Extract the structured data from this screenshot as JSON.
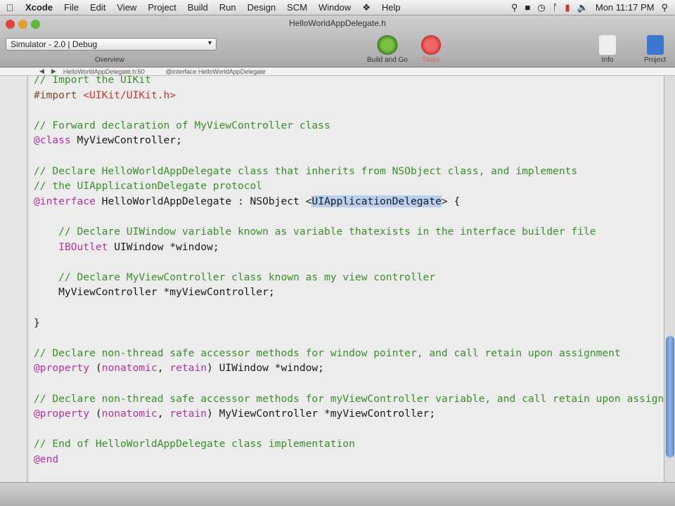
{
  "menubar": {
    "app": "Xcode",
    "items": [
      "File",
      "Edit",
      "View",
      "Project",
      "Build",
      "Run",
      "Design",
      "SCM",
      "Window",
      "Help"
    ],
    "clock": "Mon 11:17 PM"
  },
  "window": {
    "title": "HelloWorldAppDelegate.h"
  },
  "toolbar": {
    "scheme": "Simulator - 2.0 | Debug",
    "overview_label": "Overview",
    "build_go": "Build and Go",
    "tasks": "Tasks",
    "info": "Info",
    "project": "Project"
  },
  "navbar": {
    "file": "HelloWorldAppDelegate.h:60",
    "symbol": "@interface HelloWorldAppDelegate"
  },
  "colors": {
    "comment": "#3a8f2a",
    "keyword": "#b3339e",
    "string": "#c33a2a",
    "selection": "#b8d0ee"
  },
  "scrollbar": {
    "thumb_start": 0.64,
    "thumb_end": 0.94
  },
  "code": [
    [
      [
        "// Import the UIKit",
        "comment"
      ]
    ],
    [
      [
        "#import ",
        "pp"
      ],
      [
        "<UIKit/UIKit.h>",
        "str"
      ]
    ],
    [],
    [
      [
        "// Forward declaration of MyViewController class",
        "comment"
      ]
    ],
    [
      [
        "@class",
        "kw"
      ],
      [
        " MyViewController;",
        ""
      ]
    ],
    [],
    [
      [
        "// Declare HelloWorldAppDelegate class that inherits from NSObject class, and implements",
        "comment"
      ]
    ],
    [
      [
        "// the UIApplicationDelegate protocol",
        "comment"
      ]
    ],
    [
      [
        "@interface",
        "kw"
      ],
      [
        " HelloWorldAppDelegate : NSObject <",
        ""
      ],
      [
        "UIApplicationDelegate",
        "sel"
      ],
      [
        "> {",
        ""
      ]
    ],
    [],
    [
      [
        "    // Declare UIWindow variable known as variable thatexists in the interface builder file",
        "comment"
      ]
    ],
    [
      [
        "    ",
        ""
      ],
      [
        "IBOutlet",
        "kw"
      ],
      [
        " UIWindow *window;",
        ""
      ]
    ],
    [],
    [
      [
        "    // Declare MyViewController class known as my view controller",
        "comment"
      ]
    ],
    [
      [
        "    MyViewController *myViewController;",
        ""
      ]
    ],
    [],
    [
      [
        "}",
        ""
      ]
    ],
    [],
    [
      [
        "// Declare non-thread safe accessor methods for window pointer, and call retain upon assignment",
        "comment"
      ]
    ],
    [
      [
        "@property",
        "kw"
      ],
      [
        " (",
        ""
      ],
      [
        "nonatomic",
        "kw"
      ],
      [
        ", ",
        ""
      ],
      [
        "retain",
        "kw"
      ],
      [
        ") UIWindow *window;",
        ""
      ]
    ],
    [],
    [
      [
        "// Declare non-thread safe accessor methods for myViewController variable, and call retain upon assignment",
        "comment"
      ]
    ],
    [
      [
        "@property",
        "kw"
      ],
      [
        " (",
        ""
      ],
      [
        "nonatomic",
        "kw"
      ],
      [
        ", ",
        ""
      ],
      [
        "retain",
        "kw"
      ],
      [
        ") MyViewController *myViewController;",
        ""
      ]
    ],
    [],
    [
      [
        "// End of HelloWorldAppDelegate class implementation",
        "comment"
      ]
    ],
    [
      [
        "@end",
        "kw"
      ]
    ]
  ]
}
